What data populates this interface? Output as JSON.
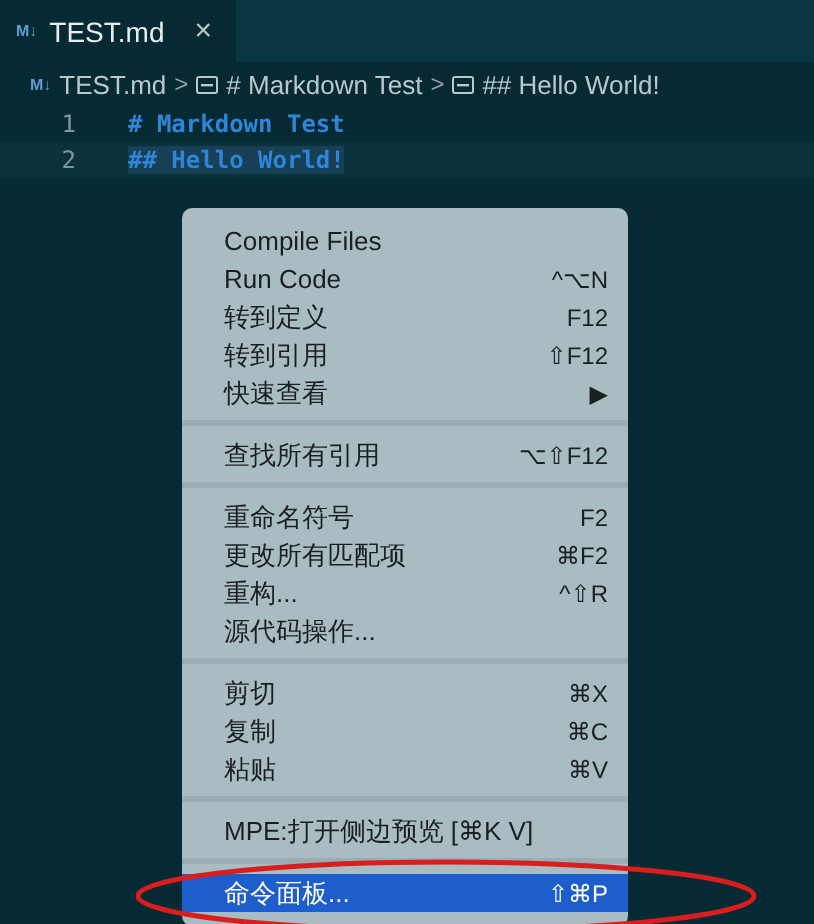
{
  "tab": {
    "badge": "M↓",
    "title": "TEST.md",
    "close": "×"
  },
  "breadcrumb": [
    {
      "kind": "file",
      "badge": "M↓",
      "label": "TEST.md"
    },
    {
      "kind": "heading",
      "label": "# Markdown Test"
    },
    {
      "kind": "heading",
      "label": "## Hello World!"
    }
  ],
  "breadcrumb_separator": ">",
  "lines": [
    {
      "number": "1",
      "text": "# Markdown Test",
      "selected": false
    },
    {
      "number": "2",
      "text": "## Hello World!",
      "selected": true
    }
  ],
  "menu": {
    "groups": [
      {
        "items": [
          {
            "label": "Compile Files",
            "selected": false
          },
          {
            "label": "Run Code",
            "shortcut": "^⌥N",
            "selected": false
          },
          {
            "label": "转到定义",
            "shortcut": "F12",
            "selected": false
          },
          {
            "label": "转到引用",
            "shortcut": "⇧F12",
            "selected": false
          },
          {
            "label": "快速查看",
            "submenu": "▶",
            "selected": false
          }
        ]
      },
      {
        "items": [
          {
            "label": "查找所有引用",
            "shortcut": "⌥⇧F12",
            "selected": false
          }
        ]
      },
      {
        "items": [
          {
            "label": "重命名符号",
            "shortcut": "F2",
            "selected": false
          },
          {
            "label": "更改所有匹配项",
            "shortcut": "⌘F2",
            "selected": false
          },
          {
            "label": "重构...",
            "shortcut": "^⇧R",
            "selected": false
          },
          {
            "label": "源代码操作...",
            "selected": false
          }
        ]
      },
      {
        "items": [
          {
            "label": "剪切",
            "shortcut": "⌘X",
            "selected": false
          },
          {
            "label": "复制",
            "shortcut": "⌘C",
            "selected": false
          },
          {
            "label": "粘贴",
            "shortcut": "⌘V",
            "selected": false
          }
        ]
      },
      {
        "items": [
          {
            "label": "MPE:打开侧边预览 [⌘K V]",
            "selected": false
          }
        ]
      },
      {
        "items": [
          {
            "label": "命令面板...",
            "shortcut": "⇧⌘P",
            "selected": true
          }
        ]
      }
    ]
  }
}
